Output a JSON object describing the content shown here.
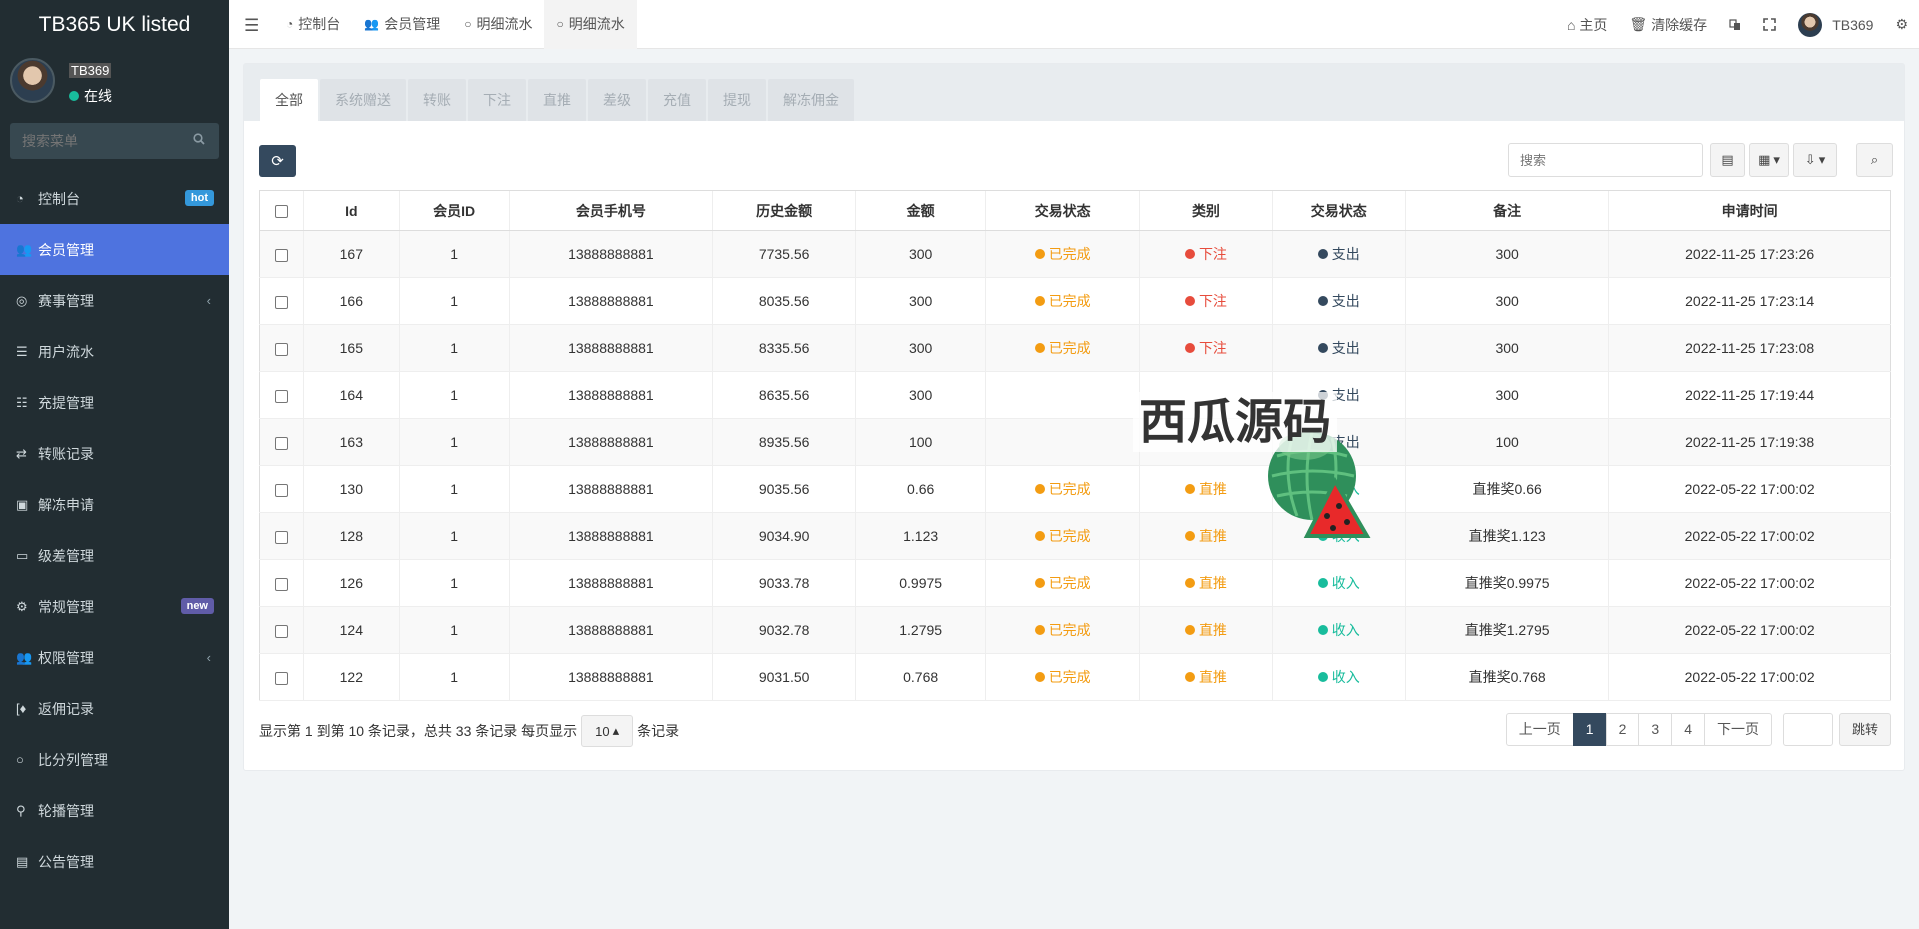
{
  "app": {
    "title": "TB365 UK listed"
  },
  "user": {
    "name": "TB369",
    "status": "在线"
  },
  "sidebar": {
    "search_placeholder": "搜索菜单",
    "items": [
      {
        "label": "控制台",
        "icon": "dashboard-icon",
        "badge": "hot"
      },
      {
        "label": "会员管理",
        "icon": "users-icon",
        "active": true
      },
      {
        "label": "赛事管理",
        "icon": "life-ring-icon",
        "submenu": true
      },
      {
        "label": "用户流水",
        "icon": "list-icon"
      },
      {
        "label": "充提管理",
        "icon": "list-alt-icon"
      },
      {
        "label": "转账记录",
        "icon": "exchange-icon"
      },
      {
        "label": "解冻申请",
        "icon": "image-icon"
      },
      {
        "label": "级差管理",
        "icon": "window-icon"
      },
      {
        "label": "常规管理",
        "icon": "cogs-icon",
        "badge": "new"
      },
      {
        "label": "权限管理",
        "icon": "group-icon",
        "submenu": true
      },
      {
        "label": "返佣记录",
        "icon": "bracket-icon"
      },
      {
        "label": "比分列管理",
        "icon": "circle-icon"
      },
      {
        "label": "轮播管理",
        "icon": "genderless-icon"
      },
      {
        "label": "公告管理",
        "icon": "bulletin-icon"
      }
    ]
  },
  "topbar": {
    "tabs": [
      {
        "label": "控制台",
        "icon": "dashboard-icon"
      },
      {
        "label": "会员管理",
        "icon": "users-icon"
      },
      {
        "label": "明细流水",
        "icon": "circle-icon"
      },
      {
        "label": "明细流水",
        "icon": "circle-icon",
        "active": true
      }
    ],
    "home_label": "主页",
    "clear_cache_label": "清除缓存",
    "user_label": "TB369"
  },
  "filter_tabs": [
    "全部",
    "系统赠送",
    "转账",
    "下注",
    "直推",
    "差级",
    "充值",
    "提现",
    "解冻佣金"
  ],
  "toolbar": {
    "search_placeholder": "搜索"
  },
  "table": {
    "columns": [
      "Id",
      "会员ID",
      "会员手机号",
      "历史金额",
      "金额",
      "交易状态",
      "类别",
      "交易状态",
      "备注",
      "申请时间"
    ],
    "rows": [
      {
        "id": "167",
        "member_id": "1",
        "phone": "13888888881",
        "history": "7735.56",
        "amount": "300",
        "status": "已完成",
        "type": "下注",
        "direction": "支出",
        "note": "300",
        "time": "2022-11-25 17:23:26"
      },
      {
        "id": "166",
        "member_id": "1",
        "phone": "13888888881",
        "history": "8035.56",
        "amount": "300",
        "status": "已完成",
        "type": "下注",
        "direction": "支出",
        "note": "300",
        "time": "2022-11-25 17:23:14"
      },
      {
        "id": "165",
        "member_id": "1",
        "phone": "13888888881",
        "history": "8335.56",
        "amount": "300",
        "status": "已完成",
        "type": "下注",
        "direction": "支出",
        "note": "300",
        "time": "2022-11-25 17:23:08"
      },
      {
        "id": "164",
        "member_id": "1",
        "phone": "13888888881",
        "history": "8635.56",
        "amount": "300",
        "status": "",
        "type": "",
        "direction": "支出",
        "note": "300",
        "time": "2022-11-25 17:19:44"
      },
      {
        "id": "163",
        "member_id": "1",
        "phone": "13888888881",
        "history": "8935.56",
        "amount": "100",
        "status": "",
        "type": "",
        "direction": "支出",
        "note": "100",
        "time": "2022-11-25 17:19:38"
      },
      {
        "id": "130",
        "member_id": "1",
        "phone": "13888888881",
        "history": "9035.56",
        "amount": "0.66",
        "status": "已完成",
        "type": "直推",
        "direction": "收入",
        "note": "直推奖0.66",
        "time": "2022-05-22 17:00:02"
      },
      {
        "id": "128",
        "member_id": "1",
        "phone": "13888888881",
        "history": "9034.90",
        "amount": "1.123",
        "status": "已完成",
        "type": "直推",
        "direction": "收入",
        "note": "直推奖1.123",
        "time": "2022-05-22 17:00:02"
      },
      {
        "id": "126",
        "member_id": "1",
        "phone": "13888888881",
        "history": "9033.78",
        "amount": "0.9975",
        "status": "已完成",
        "type": "直推",
        "direction": "收入",
        "note": "直推奖0.9975",
        "time": "2022-05-22 17:00:02"
      },
      {
        "id": "124",
        "member_id": "1",
        "phone": "13888888881",
        "history": "9032.78",
        "amount": "1.2795",
        "status": "已完成",
        "type": "直推",
        "direction": "收入",
        "note": "直推奖1.2795",
        "time": "2022-05-22 17:00:02"
      },
      {
        "id": "122",
        "member_id": "1",
        "phone": "13888888881",
        "history": "9031.50",
        "amount": "0.768",
        "status": "已完成",
        "type": "直推",
        "direction": "收入",
        "note": "直推奖0.768",
        "time": "2022-05-22 17:00:02"
      }
    ]
  },
  "footer": {
    "summary": "显示第 1 到第 10 条记录，总共 33 条记录 每页显示",
    "page_size": "10",
    "suffix": "条记录",
    "prev": "上一页",
    "pages": [
      "1",
      "2",
      "3",
      "4"
    ],
    "current_page": "1",
    "next": "下一页",
    "jump": "跳转"
  },
  "watermark": {
    "text": "西瓜源码"
  },
  "colors": {
    "sidebar_bg": "#222d32",
    "active_menu": "#4e73df",
    "status_done": "#f39c12",
    "type_bet": "#e74c3c",
    "type_direct": "#f39c12",
    "dir_out": "#34495e",
    "dir_in": "#18bc9c",
    "primary_dark": "#34495e"
  }
}
